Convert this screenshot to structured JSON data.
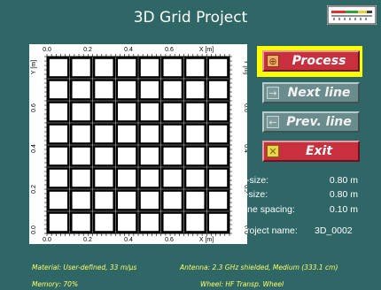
{
  "title": "3D Grid Project",
  "grid": {
    "x_ticks": [
      "0.0",
      "0.2",
      "0.4",
      "0.6"
    ],
    "x_unit": "X [m]",
    "y_ticks": [
      "0.0",
      "0.2",
      "0.4",
      "0.6"
    ],
    "y_unit": "Y [m]",
    "columns": 8,
    "rows": 8
  },
  "buttons": {
    "process": "Process",
    "next_line": "Next line",
    "prev_line": "Prev. line",
    "exit": "Exit"
  },
  "info": {
    "x_size_label": "X-size:",
    "x_size_value": "0.80 m",
    "y_size_label": "Y-size:",
    "y_size_value": "0.80 m",
    "line_spacing_label": "Line spacing:",
    "line_spacing_value": "0.10 m",
    "project_name_label": "Project name:",
    "project_name_value": "3D_0002"
  },
  "footer": {
    "material": "Material: User-defined, 33 m/µs",
    "antenna": "Antenna: 2.3 GHz shielded, Medium (333.1 cm)",
    "memory": "Memory: 70%",
    "wheel": "Wheel: HF Transp. Wheel"
  },
  "colors": {
    "background": "#2e6766",
    "accent_red": "#c8303e",
    "highlight_yellow": "#ffff00",
    "footer_text": "#ffff66"
  },
  "icons": {
    "logo": "signal-strength-logo",
    "process": "crosshair-icon",
    "next_line": "arrow-right-icon",
    "prev_line": "arrow-left-icon",
    "exit": "x-box-icon"
  }
}
